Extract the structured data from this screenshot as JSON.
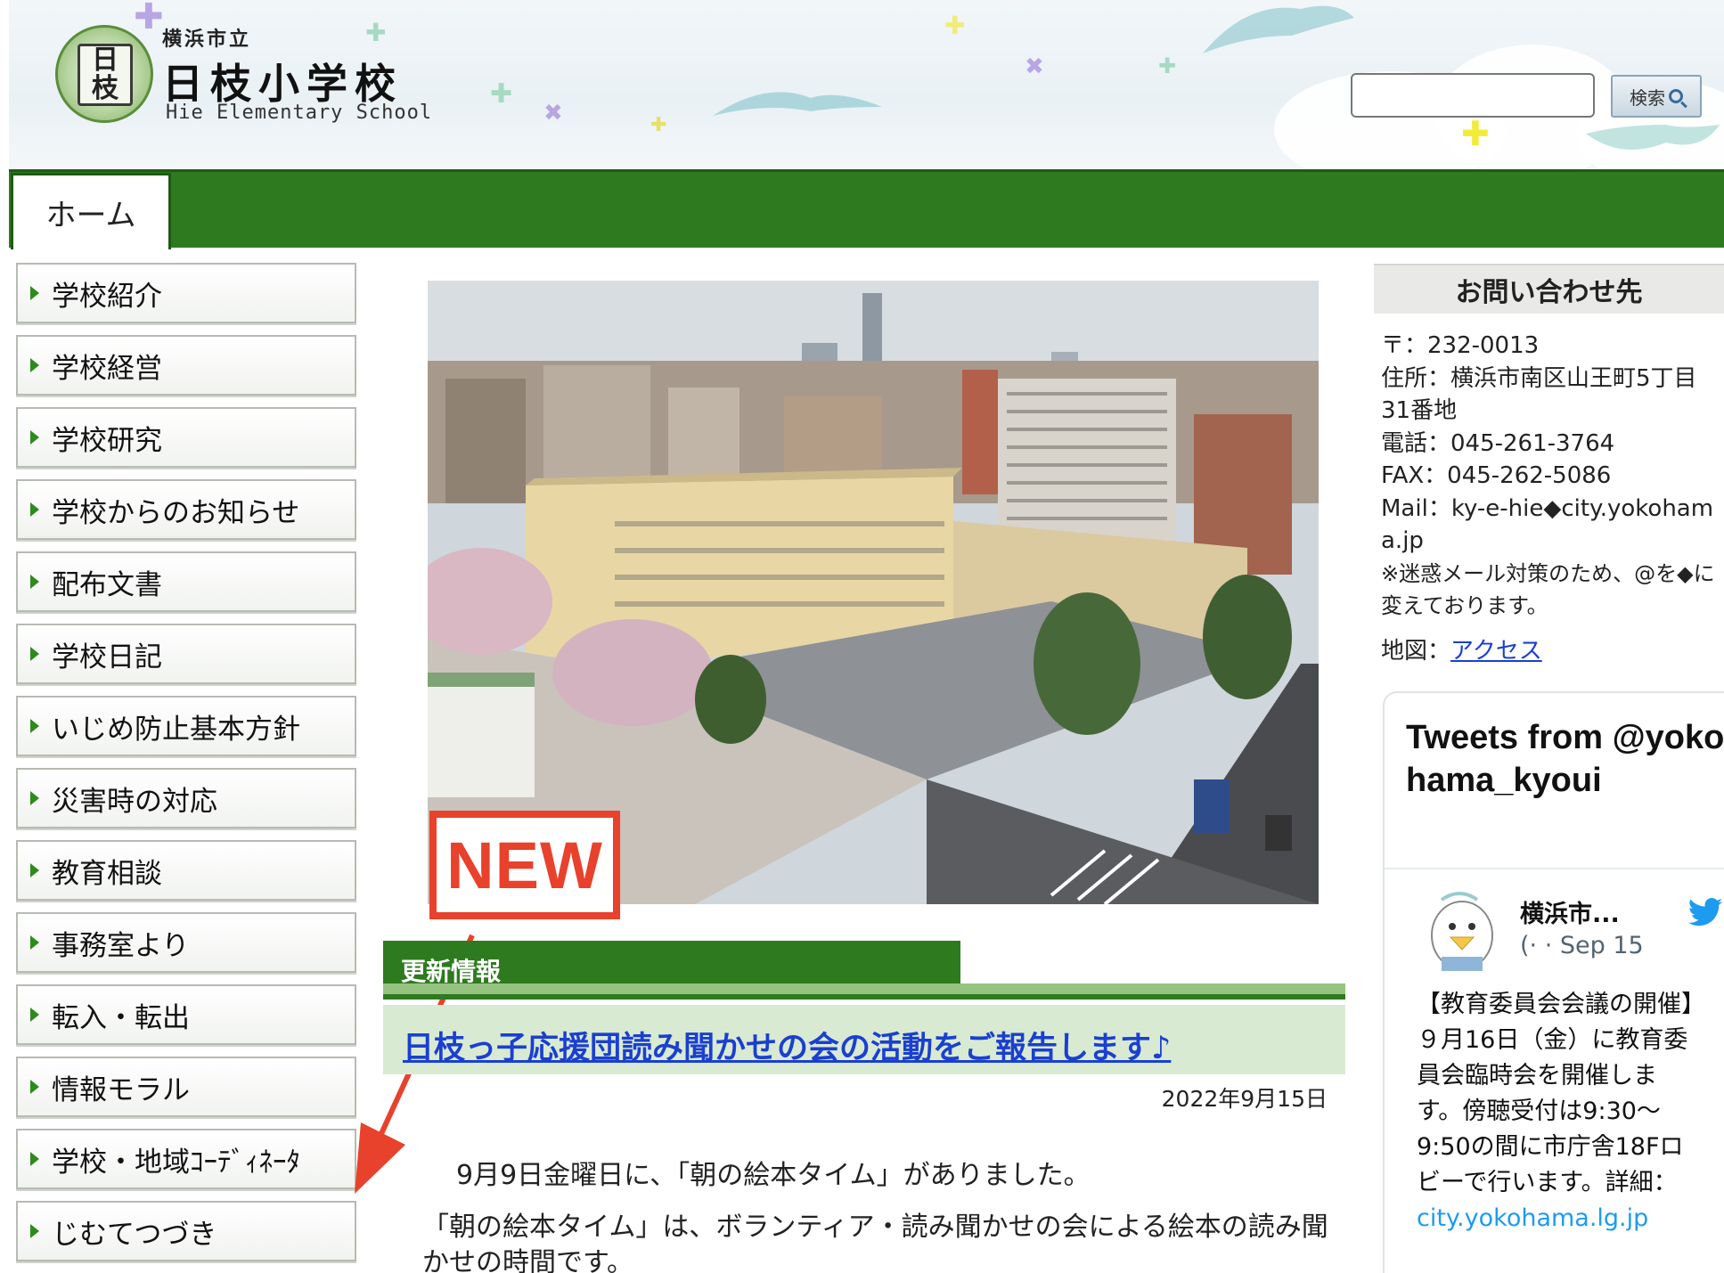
{
  "header": {
    "logo_emblem_text": "日枝",
    "school_city": "横浜市立",
    "school_name": "日枝小学校",
    "school_name_en": "Hie Elementary School",
    "search_placeholder": "",
    "search_button_label": "検索"
  },
  "nav": {
    "home_tab": "ホーム"
  },
  "left_menu": {
    "items": [
      "学校紹介",
      "学校経営",
      "学校研究",
      "学校からのお知らせ",
      "配布文書",
      "学校日記",
      "いじめ防止基本方針",
      "災害時の対応",
      "教育相談",
      "事務室より",
      "転入・転出",
      "情報モラル",
      "学校・地域ｺｰﾃﾞｨﾈｰﾀ",
      "じむてつづき"
    ]
  },
  "main": {
    "new_badge": "NEW",
    "update_heading": "更新情報",
    "update_title": "日枝っ子応援団読み聞かせの会の活動をご報告します♪",
    "update_date": "2022年9月15日",
    "paragraph1": "9月9日金曜日に、「朝の絵本タイム」がありました。",
    "paragraph2": "「朝の絵本タイム」は、ボランティア・読み聞かせの会による絵本の読み聞かせの時間です。"
  },
  "contact": {
    "heading": "お問い合わせ先",
    "postal": "〒：232-0013",
    "address": "住所：横浜市南区山王町5丁目31番地",
    "phone": "電話：045-261-3764",
    "fax": "FAX：045-262-5086",
    "mail": "Mail：ky-e-hie◆city.yokohama.jp",
    "note": "※迷惑メール対策のため、@を◆に変えております。",
    "map_label": "地図：",
    "map_link": "アクセス"
  },
  "twitter": {
    "title": "Tweets from @yokohama_kyoui",
    "account_name": "横浜市...",
    "meta": "(· · Sep 15",
    "text": "【教育委員会会議の開催】９月16日（金）に教育委員会臨時会を開催します。傍聴受付は9:30～9:50の間に市庁舎18Fロビーで行います。詳細：",
    "link": "city.yokohama.lg.jp"
  },
  "colors": {
    "nav_green": "#2e7a1f",
    "update_light_green": "#d9ead2",
    "link_blue": "#1a3fd1",
    "badge_red": "#e8412c",
    "twitter_blue": "#1d9bf0"
  }
}
